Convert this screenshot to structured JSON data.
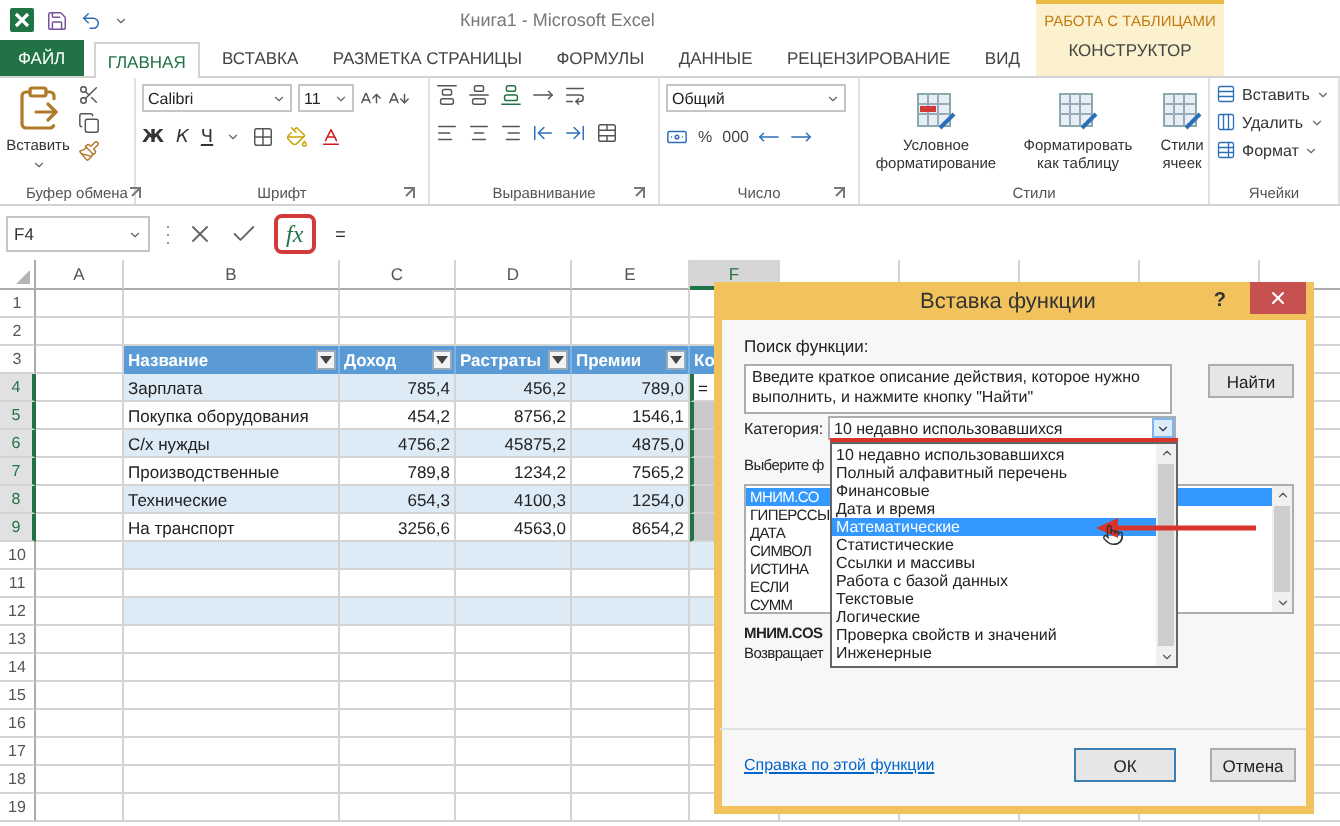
{
  "window": {
    "title": "Книга1 - Microsoft Excel",
    "contextual_title": "РАБОТА С ТАБЛИЦАМИ"
  },
  "tabs": [
    {
      "label": "ФАЙЛ",
      "kind": "file",
      "selected": false
    },
    {
      "label": "ГЛАВНАЯ",
      "kind": "normal",
      "selected": true
    },
    {
      "label": "ВСТАВКА",
      "kind": "normal",
      "selected": false
    },
    {
      "label": "РАЗМЕТКА СТРАНИЦЫ",
      "kind": "normal",
      "selected": false
    },
    {
      "label": "ФОРМУЛЫ",
      "kind": "normal",
      "selected": false
    },
    {
      "label": "ДАННЫЕ",
      "kind": "normal",
      "selected": false
    },
    {
      "label": "РЕЦЕНЗИРОВАНИЕ",
      "kind": "normal",
      "selected": false
    },
    {
      "label": "ВИД",
      "kind": "normal",
      "selected": false
    },
    {
      "label": "КОНСТРУКТОР",
      "kind": "contextual",
      "selected": false
    }
  ],
  "ribbon": {
    "groups": [
      {
        "kind": "clipboard",
        "label": "Буфер обмена",
        "paste": "Вставить"
      },
      {
        "kind": "font",
        "label": "Шрифт",
        "font_name": "Calibri",
        "font_size": "11",
        "styles": [
          "Ж",
          "К",
          "Ч"
        ]
      },
      {
        "kind": "alignment",
        "label": "Выравнивание"
      },
      {
        "kind": "number",
        "label": "Число",
        "format": "Общий",
        "percent": "%",
        "thousands": "000"
      },
      {
        "kind": "styles",
        "label": "Стили",
        "buttons": [
          "Условное форматирование",
          "Форматировать как таблицу",
          "Стили ячеек"
        ]
      },
      {
        "kind": "cells",
        "label": "Ячейки",
        "buttons": [
          "Вставить",
          "Удалить",
          "Формат"
        ]
      }
    ]
  },
  "formula_bar": {
    "name_box": "F4",
    "fx": "fx",
    "formula": "="
  },
  "sheet": {
    "columns": [
      {
        "label": "A",
        "selected": false
      },
      {
        "label": "B",
        "selected": false
      },
      {
        "label": "C",
        "selected": false
      },
      {
        "label": "D",
        "selected": false
      },
      {
        "label": "E",
        "selected": false
      },
      {
        "label": "F",
        "selected": true
      }
    ],
    "rows": [
      {
        "number": "1",
        "kind": "blank",
        "selected": false,
        "band": false
      },
      {
        "number": "2",
        "kind": "blank",
        "selected": false,
        "band": false
      },
      {
        "number": "3",
        "kind": "header",
        "selected": false,
        "band": false,
        "cells": [
          {
            "label": "Название",
            "filter": true
          },
          {
            "label": "Доход",
            "filter": true
          },
          {
            "label": "Растраты",
            "filter": true
          },
          {
            "label": "Премии",
            "filter": true
          },
          {
            "label": "Ко"
          }
        ]
      },
      {
        "number": "4",
        "kind": "data",
        "selected": true,
        "band": true,
        "cells": [
          "Зарплата",
          "785,4",
          "456,2",
          "789,0",
          "="
        ]
      },
      {
        "number": "5",
        "kind": "data",
        "selected": true,
        "band": false,
        "cells": [
          "Покупка оборудования",
          "454,2",
          "8756,2",
          "1546,1"
        ]
      },
      {
        "number": "6",
        "kind": "data",
        "selected": true,
        "band": true,
        "cells": [
          "С/х нужды",
          "4756,2",
          "45875,2",
          "4875,0"
        ]
      },
      {
        "number": "7",
        "kind": "data",
        "selected": true,
        "band": false,
        "cells": [
          "Производственные",
          "789,8",
          "1234,2",
          "7565,2"
        ]
      },
      {
        "number": "8",
        "kind": "data",
        "selected": true,
        "band": true,
        "cells": [
          "Технические",
          "654,3",
          "4100,3",
          "1254,0"
        ]
      },
      {
        "number": "9",
        "kind": "data",
        "selected": true,
        "band": false,
        "cells": [
          "На транспорт",
          "3256,6",
          "4563,0",
          "8654,2"
        ]
      },
      {
        "number": "10",
        "kind": "blank",
        "selected": false,
        "band": true
      },
      {
        "number": "11",
        "kind": "blank",
        "selected": false,
        "band": false
      },
      {
        "number": "12",
        "kind": "blank",
        "selected": false,
        "band": true
      },
      {
        "number": "13",
        "kind": "blank",
        "selected": false,
        "band": false
      },
      {
        "number": "14",
        "kind": "blank",
        "selected": false,
        "band": false
      },
      {
        "number": "15",
        "kind": "blank",
        "selected": false,
        "band": false
      },
      {
        "number": "16",
        "kind": "blank",
        "selected": false,
        "band": false
      },
      {
        "number": "17",
        "kind": "blank",
        "selected": false,
        "band": false
      },
      {
        "number": "18",
        "kind": "blank",
        "selected": false,
        "band": false
      },
      {
        "number": "19",
        "kind": "blank",
        "selected": false,
        "band": false
      }
    ]
  },
  "dialog": {
    "title": "Вставка функции",
    "help": "?",
    "search_label": "Поиск функции:",
    "search_text": "Введите краткое описание действия, которое нужно выполнить, и нажмите кнопку \"Найти\"",
    "find_button": "Найти",
    "category_label": "Категория:",
    "category_value": "10 недавно использовавшихся",
    "category_options": [
      {
        "label": "10 недавно использовавшихся",
        "selected": false
      },
      {
        "label": "Полный алфавитный перечень",
        "selected": false
      },
      {
        "label": "Финансовые",
        "selected": false
      },
      {
        "label": "Дата и время",
        "selected": false
      },
      {
        "label": "Математические",
        "selected": true
      },
      {
        "label": "Статистические",
        "selected": false
      },
      {
        "label": "Ссылки и массивы",
        "selected": false
      },
      {
        "label": "Работа с базой данных",
        "selected": false
      },
      {
        "label": "Текстовые",
        "selected": false
      },
      {
        "label": "Логические",
        "selected": false
      },
      {
        "label": "Проверка свойств и значений",
        "selected": false
      },
      {
        "label": "Инженерные",
        "selected": false
      }
    ],
    "function_label": "Выберите ф",
    "functions": [
      {
        "label": "МНИМ.СО",
        "selected": true
      },
      {
        "label": "ГИПЕРССЫ",
        "selected": false
      },
      {
        "label": "ДАТА",
        "selected": false
      },
      {
        "label": "СИМВОЛ",
        "selected": false
      },
      {
        "label": "ИСТИНА",
        "selected": false
      },
      {
        "label": "ЕСЛИ",
        "selected": false
      },
      {
        "label": "СУММ",
        "selected": false
      }
    ],
    "function_name": "МНИМ.COS",
    "description": "Возвращает",
    "help_link": "Справка по этой функции",
    "ok_button": "ОК",
    "cancel_button": "Отмена"
  }
}
